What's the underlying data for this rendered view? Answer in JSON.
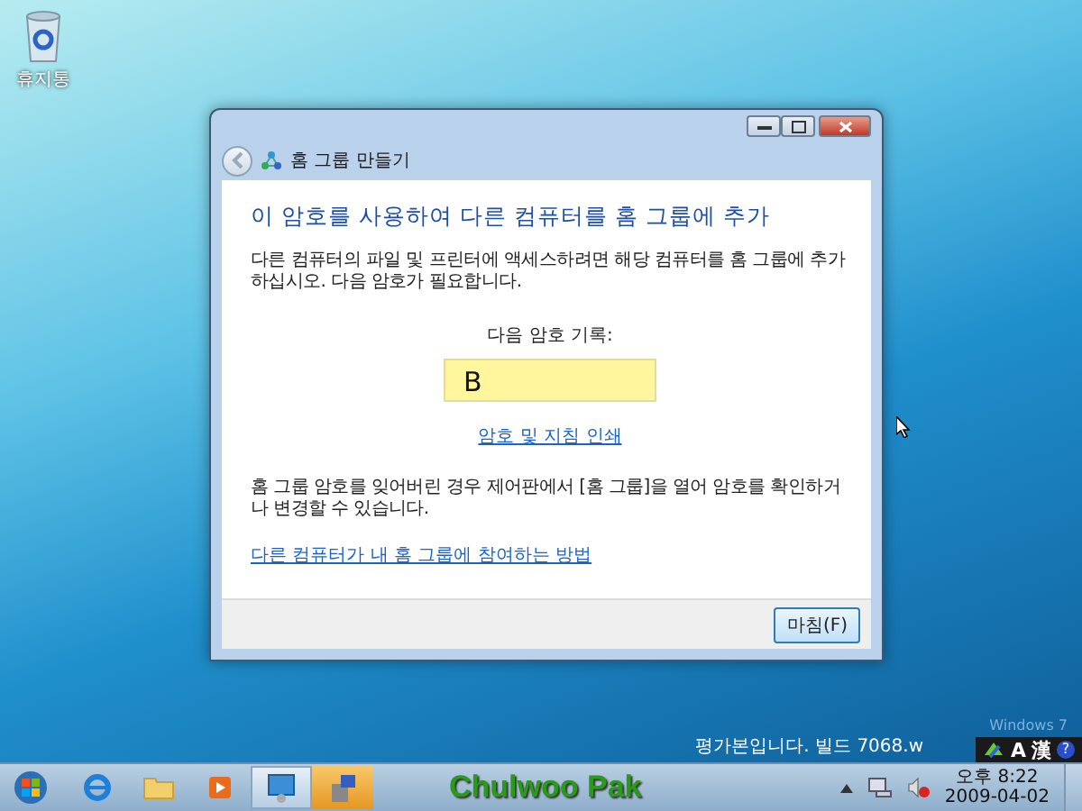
{
  "desktop": {
    "icons": [
      {
        "label": "휴지통"
      }
    ],
    "watermark": {
      "line1": "Windows 7",
      "line2": "평가본입니다. 빌드 7068.w"
    }
  },
  "window": {
    "title": "홈 그룹 만들기",
    "heading": "이 암호를 사용하여 다른 컴퓨터를 홈 그룹에 추가",
    "intro": "다른 컴퓨터의 파일 및 프린터에 액세스하려면 해당 컴퓨터를 홈 그룹에 추가하십시오. 다음 암호가 필요합니다.",
    "password_label": "다음 암호 기록:",
    "password": "B",
    "print_link": "암호 및 지침 인쇄",
    "note": "홈 그룹 암호를 잊어버린 경우 제어판에서 [홈 그룹]을 열어 암호를 확인하거나 변경할 수 있습니다.",
    "help_link": "다른 컴퓨터가 내 홈 그룹에 참여하는 방법",
    "buttons": [
      "마침(F)"
    ]
  },
  "language_bar": {
    "items": [
      "A",
      "漢",
      "?"
    ]
  },
  "taskbar": {
    "buttons": [
      {
        "kind": "ie",
        "selected": false
      },
      {
        "kind": "folder",
        "selected": false
      },
      {
        "kind": "media",
        "selected": false
      },
      {
        "kind": "homegroup",
        "selected": true
      },
      {
        "kind": "installer",
        "selected": false
      }
    ],
    "signature": "Chulwoo Pak",
    "tray": {
      "time": "오후 8:22",
      "date": "2009-04-02"
    }
  }
}
